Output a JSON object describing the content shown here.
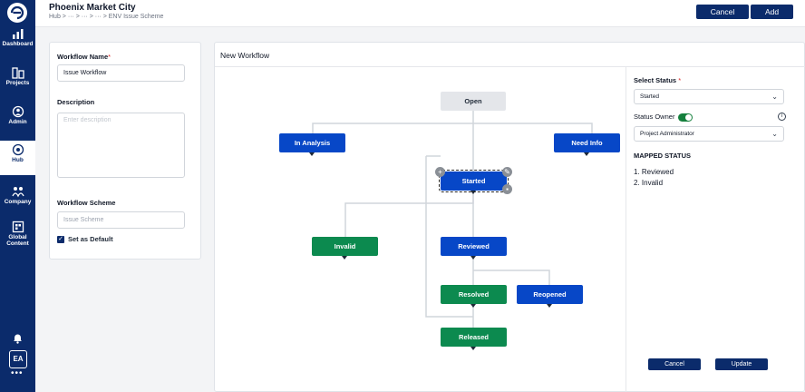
{
  "header": {
    "title": "Phoenix Market City",
    "breadcrumb": "Hub > ··· > ··· > ··· > ENV Issue Scheme",
    "cancel_label": "Cancel",
    "add_label": "Add"
  },
  "sidebar": {
    "items": [
      {
        "label": "Dashboard"
      },
      {
        "label": "Projects"
      },
      {
        "label": "Admin"
      },
      {
        "label": "Hub"
      },
      {
        "label": "Company"
      },
      {
        "label": "Global Content"
      }
    ],
    "avatar": "EA"
  },
  "form": {
    "workflow_name_label": "Workflow Name",
    "workflow_name_value": "Issue Workflow",
    "description_label": "Description",
    "description_placeholder": "Enter description",
    "scheme_label": "Workflow Scheme",
    "scheme_placeholder": "Issue Scheme",
    "default_label": "Set as Default"
  },
  "workflow": {
    "title": "New Workflow",
    "nodes": {
      "open": "Open",
      "in_analysis": "In Analysis",
      "need_info": "Need Info",
      "started": "Started",
      "invalid": "Invalid",
      "reviewed": "Reviewed",
      "resolved": "Resolved",
      "reopened": "Reopened",
      "released": "Released"
    }
  },
  "status_panel": {
    "select_status_label": "Select Status",
    "selected_status": "Started",
    "owner_label": "Status Owner",
    "owner_value": "Project Administrator",
    "mapped_title": "MAPPED STATUS",
    "mapped": [
      "1. Reviewed",
      "2. Invalid"
    ],
    "cancel_label": "Cancel",
    "update_label": "Update"
  },
  "colors": {
    "primary": "#0b2b6b",
    "node_blue": "#0747c7",
    "node_green": "#0c8a4f",
    "toggle_on": "#15803d"
  }
}
